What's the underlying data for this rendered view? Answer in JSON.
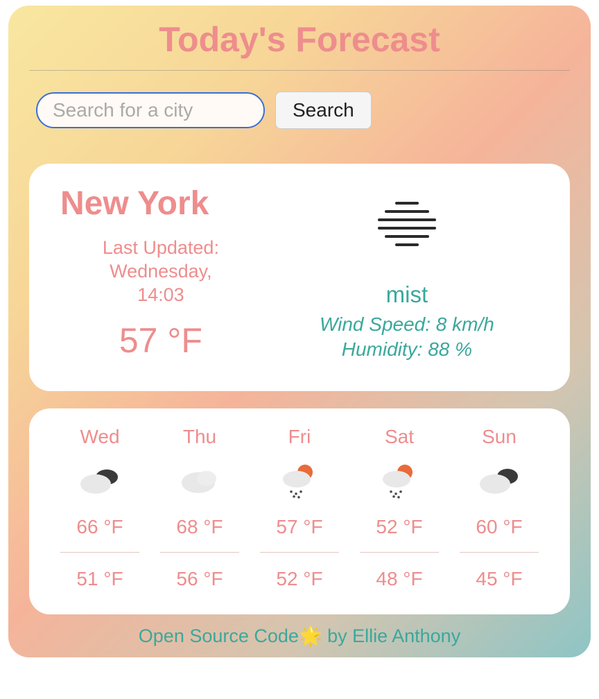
{
  "title": "Today's Forecast",
  "search": {
    "placeholder": "Search for a city",
    "button_label": "Search"
  },
  "current": {
    "city": "New York",
    "last_updated_label": "Last Updated:",
    "last_updated_day": "Wednesday,",
    "last_updated_time": "14:03",
    "temp": "57 °F",
    "condition": "mist",
    "wind_label": "Wind Speed: 8 km/h",
    "humidity_label": "Humidity: 88 %",
    "icon": "mist"
  },
  "forecast": [
    {
      "day": "Wed",
      "icon": "cloud-dark",
      "high": "66 °F",
      "low": "51 °F"
    },
    {
      "day": "Thu",
      "icon": "cloud-light",
      "high": "68 °F",
      "low": "56 °F"
    },
    {
      "day": "Fri",
      "icon": "sun-rain",
      "high": "57 °F",
      "low": "52 °F"
    },
    {
      "day": "Sat",
      "icon": "sun-rain",
      "high": "52 °F",
      "low": "48 °F"
    },
    {
      "day": "Sun",
      "icon": "cloud-dark2",
      "high": "60 °F",
      "low": "45 °F"
    }
  ],
  "footer": {
    "link_text": "Open Source Code",
    "emoji": "🌟",
    "by_text": " by Ellie Anthony"
  }
}
